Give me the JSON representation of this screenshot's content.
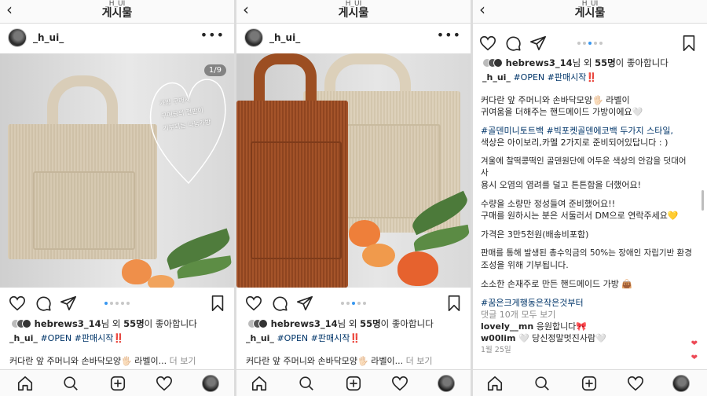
{
  "header": {
    "username": "_H_UI_",
    "title": "게시물"
  },
  "post": {
    "author": "_h_ui_",
    "more_label": "•••",
    "image_counter": "1/9",
    "photo_note": [
      "가방 구매시",
      "구매금의 절반이",
      "기부되는 나눔가방"
    ],
    "liked_by_user": "hebrews3_14",
    "likes_text_mid": "님 외 ",
    "likes_count": "55명",
    "likes_text_end": "이 좋아합니다",
    "caption_author": "_h_ui_",
    "hashtag_open": "#OPEN",
    "hashtag_sale": "#판매시작",
    "exclaim": "‼️",
    "caption_preview": "커다란 앞 주머니와 손바닥모양🖐🏻 라벨이...",
    "more_link": "더 보기",
    "full_caption": [
      "커다란 앞 주머니와 손바닥모양🖐🏻 라벨이",
      "귀여움을 더해주는 핸드메이드 가방이에요🤍",
      "",
      "#골덴미니토트백 #빅포켓골덴에코백 두가지 스타일,",
      "색상은 아이보리,카멜 2가지로 준비되어있답니다 : )",
      "",
      "겨울에 찰떡콩떡인 골덴원단에 어두운 색상의 안감을 덧대어 사",
      "용시 오염의 염려를 덜고 튼튼함을 더했어요!",
      "",
      "수량을 소량만 정성들여 준비했어요!!",
      "구매를 원하시는 분은 서둘러서 DM으로 연락주세요💛",
      "",
      "가격은 3만5천원(배송비포함)",
      "",
      "판매를 통해 발생된 총수익금의 50%는 장애인 자립기반 환경",
      "조성을 위해 기부됩니다.",
      "",
      "소소한 손재주로 만든 핸드메이드 가방 👜",
      "",
      "#꿈은크게행동은작은것부터"
    ],
    "view_comments": "댓글 10개 모두 보기",
    "comments": [
      {
        "user": "lovely__mn",
        "text": "응원합니다🎀"
      },
      {
        "user": "w00lim",
        "text": "🤍 당신정말멋진사람🤍"
      }
    ],
    "date": "1월 25일"
  },
  "icons": {
    "back": "‹",
    "like": "heart-icon",
    "comment": "comment-icon",
    "share": "paper-plane-icon",
    "save": "bookmark-icon",
    "nav": [
      "home-icon",
      "search-icon",
      "add-post-icon",
      "activity-heart-icon",
      "profile-avatar"
    ]
  },
  "colors": {
    "hashtag": "#003569",
    "accent_dot": "#3897f0",
    "heart_red": "#ed4956"
  }
}
